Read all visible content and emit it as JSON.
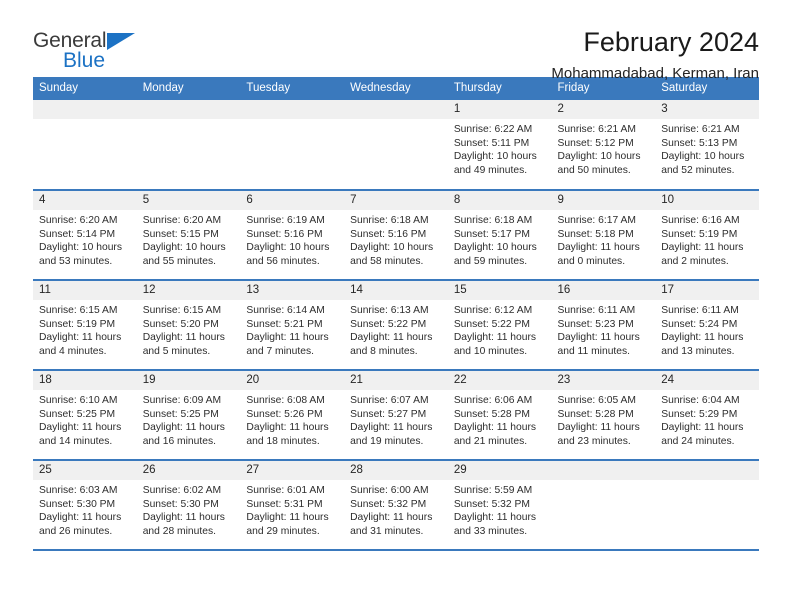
{
  "logo": {
    "line1": "General",
    "line2": "Blue",
    "triangle_color": "#1c72c4",
    "text_color": "#3b3b3b"
  },
  "header": {
    "title": "February 2024",
    "subtitle": "Mohammadabad, Kerman, Iran"
  },
  "colors": {
    "header_blue": "#3a79bd",
    "daynum_band": "#f0f0f0",
    "body_text": "#2d2d2d"
  },
  "calendar": {
    "weekday_headers": [
      "Sunday",
      "Monday",
      "Tuesday",
      "Wednesday",
      "Thursday",
      "Friday",
      "Saturday"
    ],
    "weeks": [
      [
        {
          "day": "",
          "lines": [
            "",
            "",
            "",
            ""
          ]
        },
        {
          "day": "",
          "lines": [
            "",
            "",
            "",
            ""
          ]
        },
        {
          "day": "",
          "lines": [
            "",
            "",
            "",
            ""
          ]
        },
        {
          "day": "",
          "lines": [
            "",
            "",
            "",
            ""
          ]
        },
        {
          "day": "1",
          "lines": [
            "Sunrise: 6:22 AM",
            "Sunset: 5:11 PM",
            "Daylight: 10 hours",
            "and 49 minutes."
          ]
        },
        {
          "day": "2",
          "lines": [
            "Sunrise: 6:21 AM",
            "Sunset: 5:12 PM",
            "Daylight: 10 hours",
            "and 50 minutes."
          ]
        },
        {
          "day": "3",
          "lines": [
            "Sunrise: 6:21 AM",
            "Sunset: 5:13 PM",
            "Daylight: 10 hours",
            "and 52 minutes."
          ]
        }
      ],
      [
        {
          "day": "4",
          "lines": [
            "Sunrise: 6:20 AM",
            "Sunset: 5:14 PM",
            "Daylight: 10 hours",
            "and 53 minutes."
          ]
        },
        {
          "day": "5",
          "lines": [
            "Sunrise: 6:20 AM",
            "Sunset: 5:15 PM",
            "Daylight: 10 hours",
            "and 55 minutes."
          ]
        },
        {
          "day": "6",
          "lines": [
            "Sunrise: 6:19 AM",
            "Sunset: 5:16 PM",
            "Daylight: 10 hours",
            "and 56 minutes."
          ]
        },
        {
          "day": "7",
          "lines": [
            "Sunrise: 6:18 AM",
            "Sunset: 5:16 PM",
            "Daylight: 10 hours",
            "and 58 minutes."
          ]
        },
        {
          "day": "8",
          "lines": [
            "Sunrise: 6:18 AM",
            "Sunset: 5:17 PM",
            "Daylight: 10 hours",
            "and 59 minutes."
          ]
        },
        {
          "day": "9",
          "lines": [
            "Sunrise: 6:17 AM",
            "Sunset: 5:18 PM",
            "Daylight: 11 hours",
            "and 0 minutes."
          ]
        },
        {
          "day": "10",
          "lines": [
            "Sunrise: 6:16 AM",
            "Sunset: 5:19 PM",
            "Daylight: 11 hours",
            "and 2 minutes."
          ]
        }
      ],
      [
        {
          "day": "11",
          "lines": [
            "Sunrise: 6:15 AM",
            "Sunset: 5:19 PM",
            "Daylight: 11 hours",
            "and 4 minutes."
          ]
        },
        {
          "day": "12",
          "lines": [
            "Sunrise: 6:15 AM",
            "Sunset: 5:20 PM",
            "Daylight: 11 hours",
            "and 5 minutes."
          ]
        },
        {
          "day": "13",
          "lines": [
            "Sunrise: 6:14 AM",
            "Sunset: 5:21 PM",
            "Daylight: 11 hours",
            "and 7 minutes."
          ]
        },
        {
          "day": "14",
          "lines": [
            "Sunrise: 6:13 AM",
            "Sunset: 5:22 PM",
            "Daylight: 11 hours",
            "and 8 minutes."
          ]
        },
        {
          "day": "15",
          "lines": [
            "Sunrise: 6:12 AM",
            "Sunset: 5:22 PM",
            "Daylight: 11 hours",
            "and 10 minutes."
          ]
        },
        {
          "day": "16",
          "lines": [
            "Sunrise: 6:11 AM",
            "Sunset: 5:23 PM",
            "Daylight: 11 hours",
            "and 11 minutes."
          ]
        },
        {
          "day": "17",
          "lines": [
            "Sunrise: 6:11 AM",
            "Sunset: 5:24 PM",
            "Daylight: 11 hours",
            "and 13 minutes."
          ]
        }
      ],
      [
        {
          "day": "18",
          "lines": [
            "Sunrise: 6:10 AM",
            "Sunset: 5:25 PM",
            "Daylight: 11 hours",
            "and 14 minutes."
          ]
        },
        {
          "day": "19",
          "lines": [
            "Sunrise: 6:09 AM",
            "Sunset: 5:25 PM",
            "Daylight: 11 hours",
            "and 16 minutes."
          ]
        },
        {
          "day": "20",
          "lines": [
            "Sunrise: 6:08 AM",
            "Sunset: 5:26 PM",
            "Daylight: 11 hours",
            "and 18 minutes."
          ]
        },
        {
          "day": "21",
          "lines": [
            "Sunrise: 6:07 AM",
            "Sunset: 5:27 PM",
            "Daylight: 11 hours",
            "and 19 minutes."
          ]
        },
        {
          "day": "22",
          "lines": [
            "Sunrise: 6:06 AM",
            "Sunset: 5:28 PM",
            "Daylight: 11 hours",
            "and 21 minutes."
          ]
        },
        {
          "day": "23",
          "lines": [
            "Sunrise: 6:05 AM",
            "Sunset: 5:28 PM",
            "Daylight: 11 hours",
            "and 23 minutes."
          ]
        },
        {
          "day": "24",
          "lines": [
            "Sunrise: 6:04 AM",
            "Sunset: 5:29 PM",
            "Daylight: 11 hours",
            "and 24 minutes."
          ]
        }
      ],
      [
        {
          "day": "25",
          "lines": [
            "Sunrise: 6:03 AM",
            "Sunset: 5:30 PM",
            "Daylight: 11 hours",
            "and 26 minutes."
          ]
        },
        {
          "day": "26",
          "lines": [
            "Sunrise: 6:02 AM",
            "Sunset: 5:30 PM",
            "Daylight: 11 hours",
            "and 28 minutes."
          ]
        },
        {
          "day": "27",
          "lines": [
            "Sunrise: 6:01 AM",
            "Sunset: 5:31 PM",
            "Daylight: 11 hours",
            "and 29 minutes."
          ]
        },
        {
          "day": "28",
          "lines": [
            "Sunrise: 6:00 AM",
            "Sunset: 5:32 PM",
            "Daylight: 11 hours",
            "and 31 minutes."
          ]
        },
        {
          "day": "29",
          "lines": [
            "Sunrise: 5:59 AM",
            "Sunset: 5:32 PM",
            "Daylight: 11 hours",
            "and 33 minutes."
          ]
        },
        {
          "day": "",
          "lines": [
            "",
            "",
            "",
            ""
          ]
        },
        {
          "day": "",
          "lines": [
            "",
            "",
            "",
            ""
          ]
        }
      ]
    ]
  }
}
